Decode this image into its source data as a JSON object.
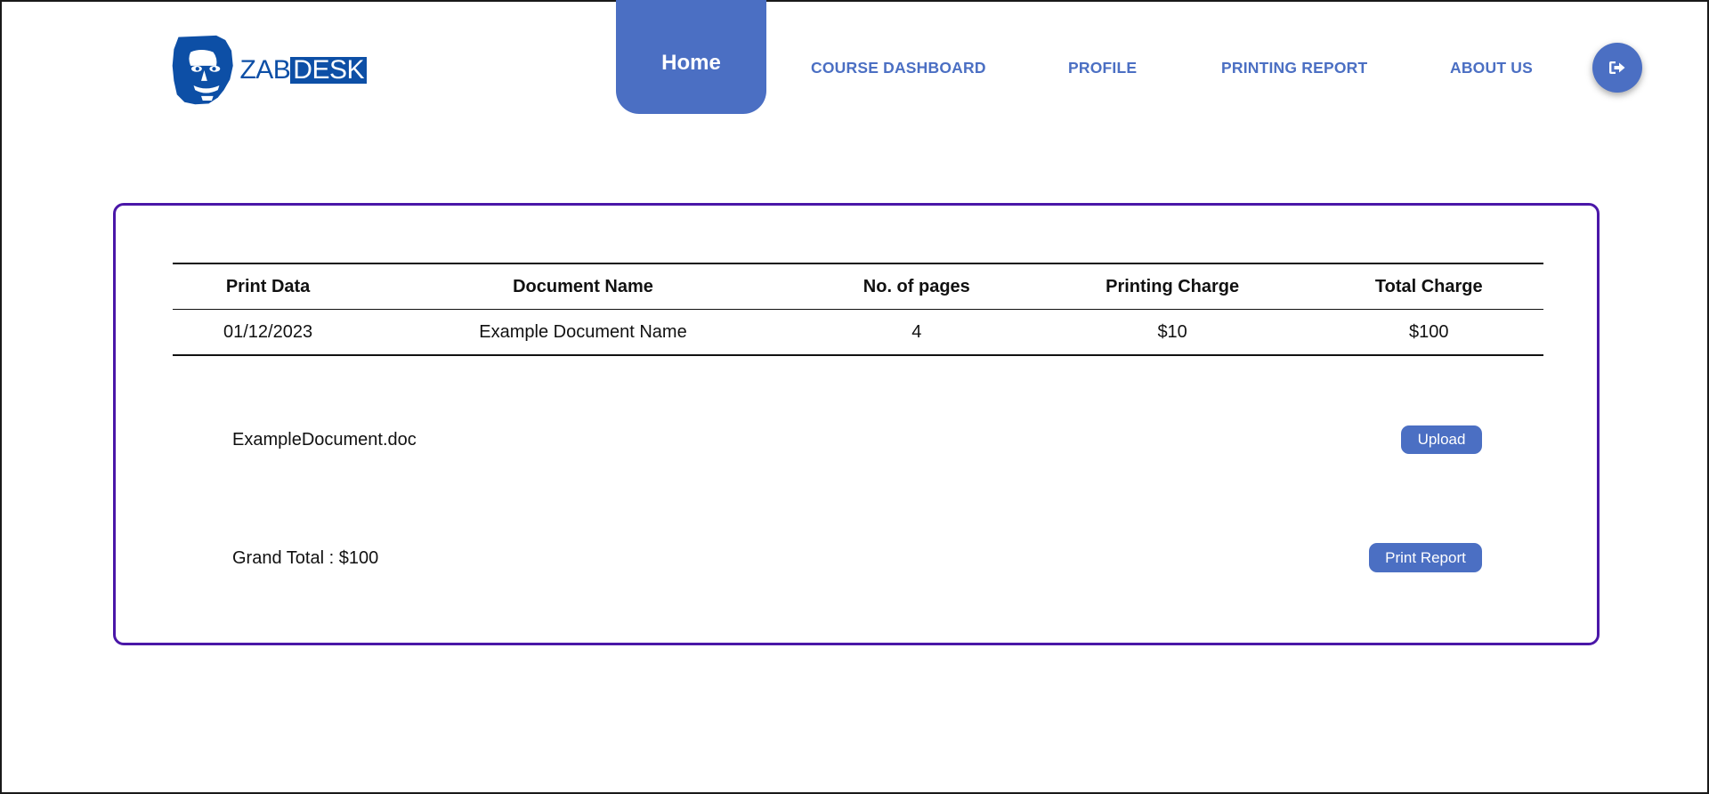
{
  "brand": {
    "zab": "ZAB",
    "desk": "DESK",
    "color": "#0d4fa6"
  },
  "nav": {
    "home": "Home",
    "course_dashboard": "COURSE DASHBOARD",
    "profile": "PROFILE",
    "printing_report": "PRINTING REPORT",
    "about_us": "ABOUT US",
    "logout_icon": "sign-out-icon",
    "accent": "#4b6fc3"
  },
  "table": {
    "headers": [
      "Print Data",
      "Document Name",
      "No. of pages",
      "Printing Charge",
      "Total Charge"
    ],
    "rows": [
      [
        "01/12/2023",
        "Example Document Name",
        "4",
        "$10",
        "$100"
      ]
    ]
  },
  "upload": {
    "file_name": "ExampleDocument.doc",
    "button_label": "Upload"
  },
  "summary": {
    "grand_total": "Grand Total : $100",
    "print_button_label": "Print Report"
  },
  "colors": {
    "card_border": "#4a17a8"
  }
}
